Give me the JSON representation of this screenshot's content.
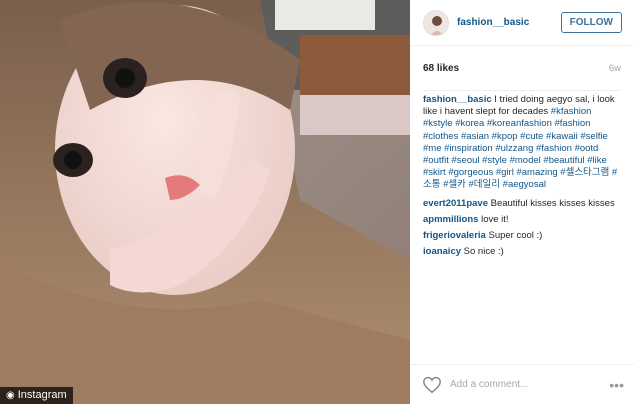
{
  "photo": {
    "credit_label": "Instagram"
  },
  "post": {
    "username": "fashion__basic",
    "follow_label": "FOLLOW",
    "likes": "68 likes",
    "age": "6w",
    "caption_user": "fashion__basic",
    "caption_text": " I tried doing aegyo sal, i look like i havent slept for decades ",
    "caption_tags": "#kfashion #kstyle #korea #koreanfashion #fashion #clothes #asian #kpop #cute #kawaii #selfie #me #inspiration #ulzzang #fashion #ootd #outfit #seoul #style #model #beautiful #like #skirt #gorgeous #girl #amazing #셀스타그램 #소통 #셀카 #데일리 #aegyosal"
  },
  "comments": [
    {
      "user": "evert2011pave",
      "text": " Beautiful kisses kisses kisses"
    },
    {
      "user": "apmmillions",
      "text": " love it!"
    },
    {
      "user": "frigeriovaleria",
      "text": " Super cool :)"
    },
    {
      "user": "ioanaicy",
      "text": " So nice :)"
    }
  ],
  "footer": {
    "add_comment_placeholder": "Add a comment...",
    "more_label": "•••"
  },
  "icons": {
    "heart": "heart-icon",
    "camera": "camera-icon",
    "more": "more-options-icon"
  }
}
